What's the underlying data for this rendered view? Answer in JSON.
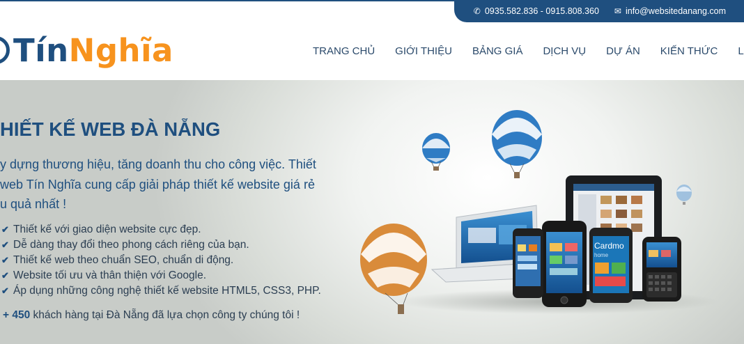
{
  "topbar": {
    "phone_icon": "phone-icon",
    "phone": "0935.582.836 - 0915.808.360",
    "email_icon": "envelope-icon",
    "email": "info@websitedanang.com"
  },
  "brand": {
    "name_part1": "Tín",
    "name_part2": "Nghĩa",
    "colors": {
      "primary": "#1f4f7f",
      "accent": "#f7931e"
    }
  },
  "nav": {
    "items": [
      "TRANG CHỦ",
      "GIỚI THIỆU",
      "BẢNG GIÁ",
      "DỊCH VỤ",
      "DỰ ÁN",
      "KIẾN THỨC",
      "LIÊN"
    ]
  },
  "hero": {
    "title": "HIẾT KẾ WEB ĐÀ NẴNG",
    "desc_lines": [
      "y dựng thương hiệu, tăng doanh thu cho công việc. Thiết",
      "web Tín Nghĩa cung cấp giải pháp thiết kế website giá rẻ",
      "u quả nhất !"
    ],
    "features": [
      "Thiết kế với giao diện website cực đẹp.",
      "Dễ dàng thay đổi theo phong cách riêng của bạn.",
      "Thiết kế web theo chuẩn SEO, chuẩn di động.",
      "Website tối ưu và thân thiện với Google.",
      "Áp dụng những công nghệ thiết kế website HTML5, CSS3, PHP."
    ],
    "check_icon": "check-icon",
    "customers_count": "+ 450",
    "customers_text": " khách hàng tại Đà Nẵng đã lựa chọn công ty chúng tôi !",
    "device_labels": {
      "tablet_app": "Cardmo",
      "tablet_sub": "home"
    }
  }
}
